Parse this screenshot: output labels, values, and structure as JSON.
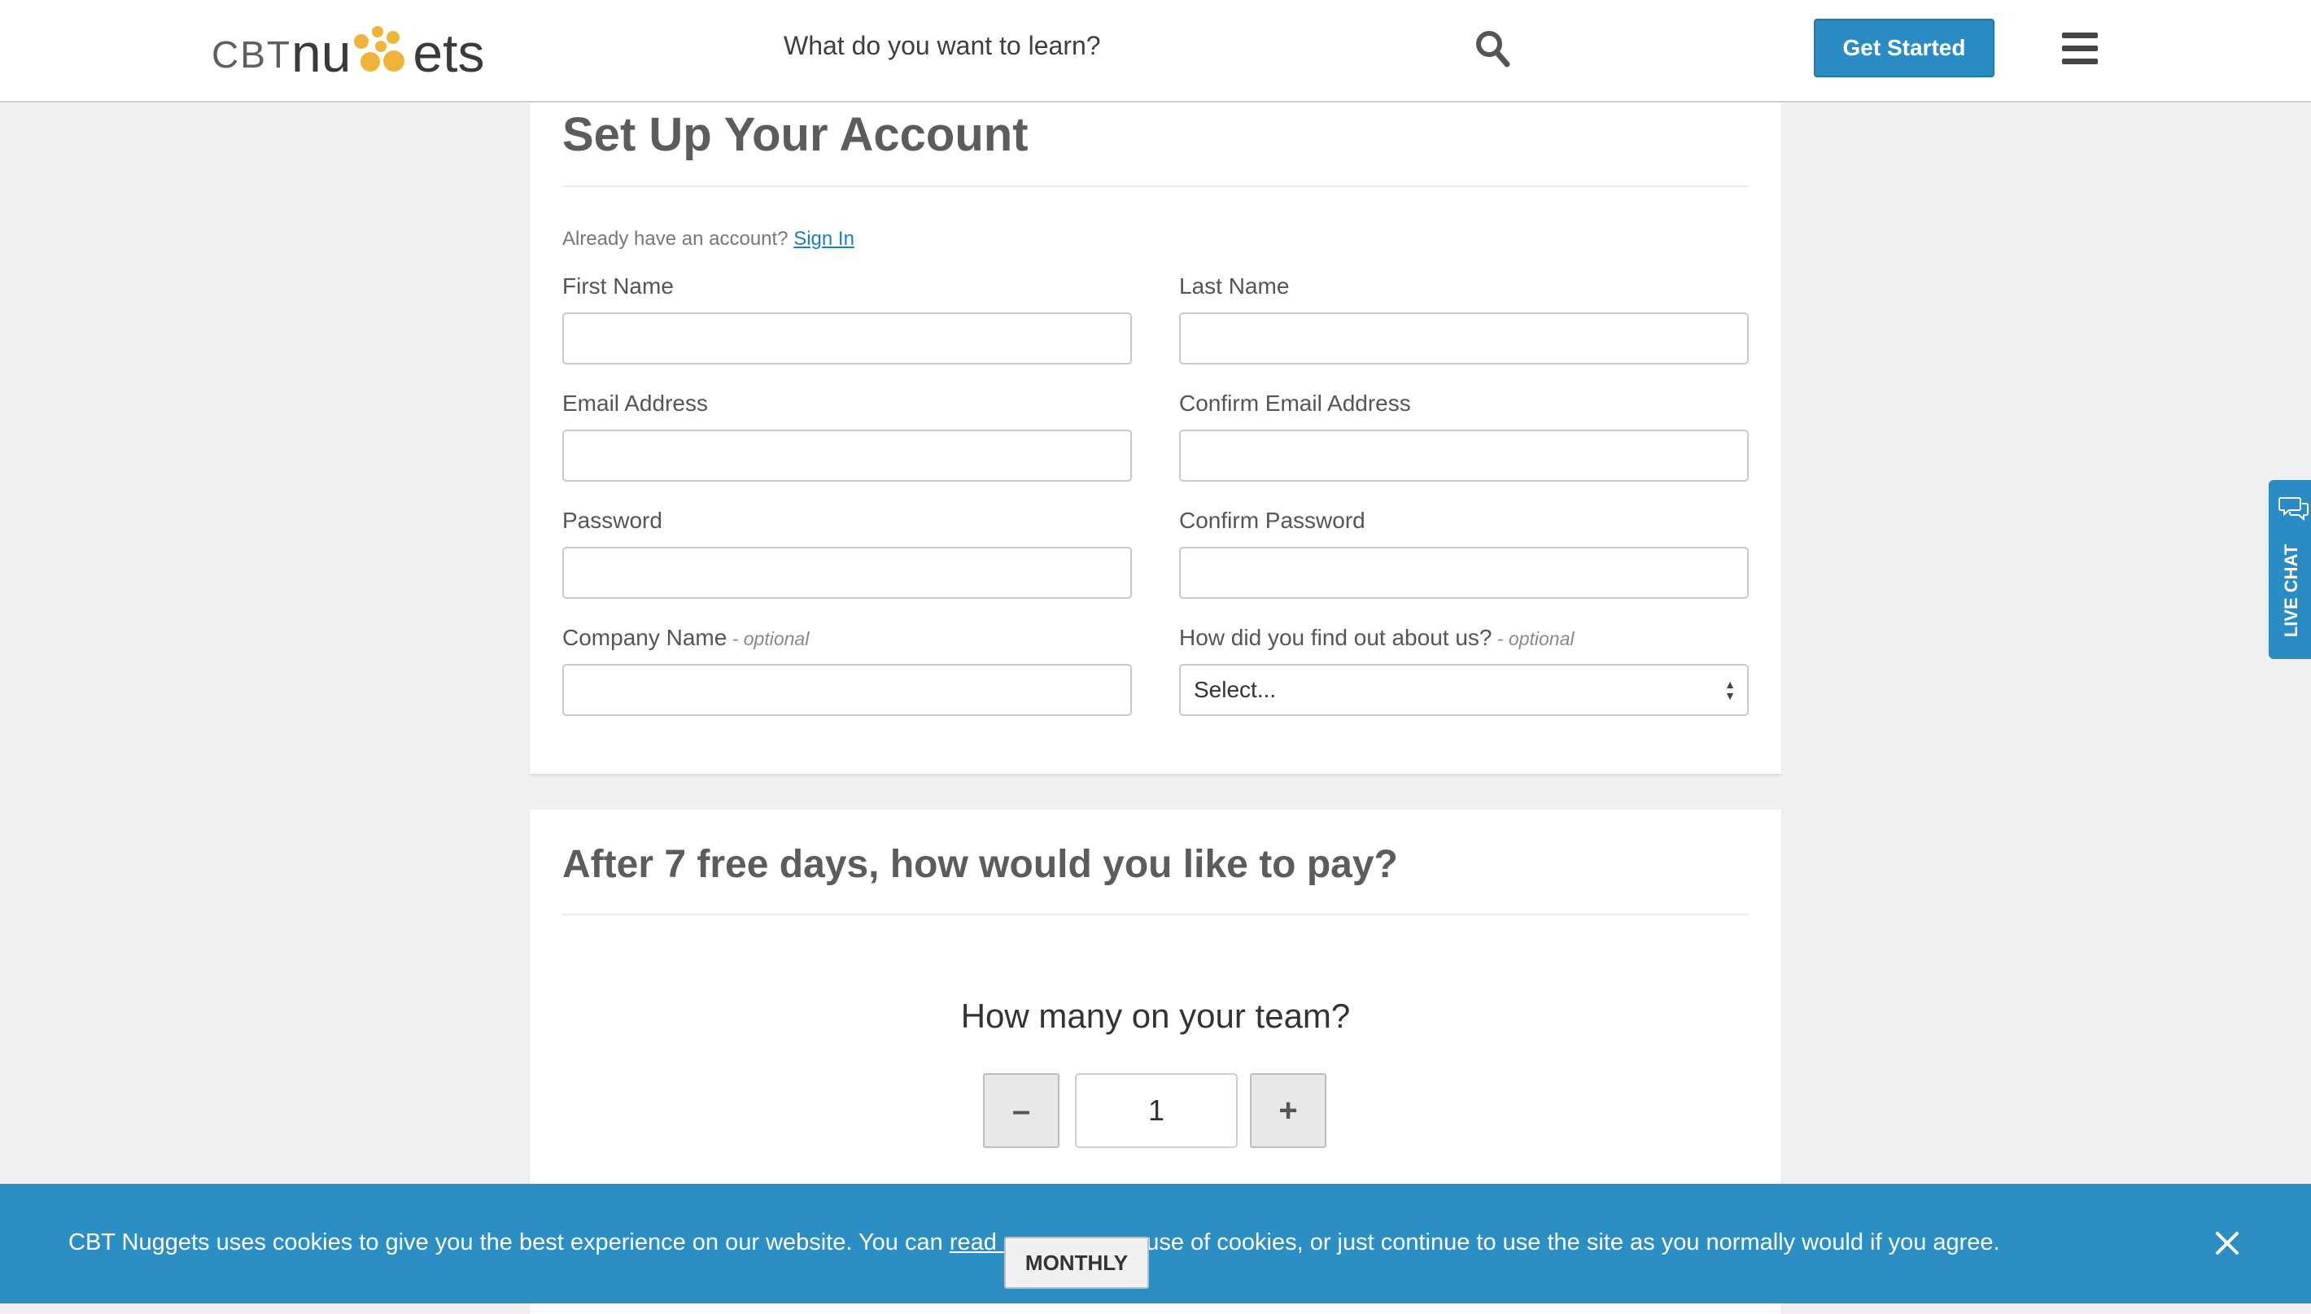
{
  "header": {
    "logo_cbt": "CBT",
    "logo_nu": "nu",
    "logo_ets": "ets",
    "search_placeholder": "What do you want to learn?",
    "get_started_label": "Get Started",
    "icons": [
      "search-icon",
      "hamburger-menu-icon"
    ]
  },
  "account": {
    "title": "Set Up Your Account",
    "already_text": "Already have an account? ",
    "sign_in_label": "Sign In",
    "fields": {
      "first_name": "First Name",
      "last_name": "Last Name",
      "email": "Email Address",
      "confirm_email": "Confirm Email Address",
      "password": "Password",
      "confirm_password": "Confirm Password",
      "company": "Company Name",
      "how_found": "How did you find out about us?",
      "optional": " - optional"
    },
    "how_found_selected": "Select...",
    "field_values": {
      "first_name": "",
      "last_name": "",
      "email": "",
      "confirm_email": "",
      "password": "",
      "confirm_password": "",
      "company": ""
    }
  },
  "payment": {
    "title": "After 7 free days, how would you like to pay?",
    "team_question": "How many on your team?",
    "minus_label": "–",
    "plus_label": "+",
    "team_count": "1"
  },
  "live_chat": {
    "label": "LIVE CHAT",
    "icon": "chat-bubbles-icon"
  },
  "cookie_bar": {
    "text_before": "CBT Nuggets uses cookies to give you the best experience on our website. You can ",
    "link_text": "read mo",
    "text_after": "use of cookies, or just continue to use the site as you normally would if you agree.",
    "close_icon": "close-icon"
  },
  "billing_toggle": {
    "monthly_label": "MONTHLY"
  },
  "colors": {
    "accent": "#2b8cc4",
    "logo_dots": "#f0b43a",
    "background": "#f0f0f0",
    "link": "#1f7ec2"
  }
}
